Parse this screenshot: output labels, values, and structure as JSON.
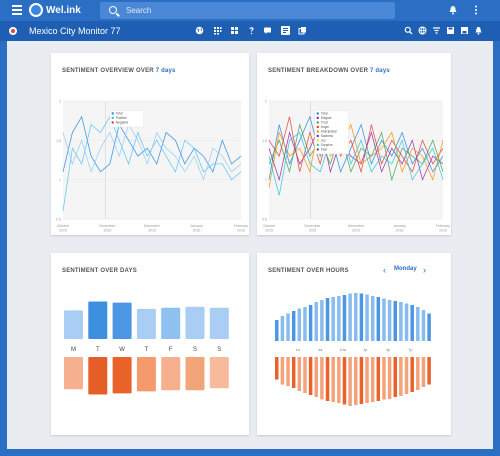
{
  "app": {
    "logo_text": "Wel.ink",
    "search_placeholder": "Search",
    "project_title": "Mexico City Monitor 77"
  },
  "toolbar_icons": [
    "globe-icon",
    "grid-icon",
    "dashboard-icon",
    "help-icon",
    "chat-icon",
    "text-icon",
    "copy-icon"
  ],
  "right_icons": [
    "search-icon",
    "globe-icon",
    "filter-icon",
    "save-icon",
    "save-alt-icon",
    "bell-icon"
  ],
  "cards": {
    "overview": {
      "title": "SENTIMENT OVERVIEW OVER",
      "range": "7 days"
    },
    "breakdown": {
      "title": "SENTIMENT BREAKDOWN OVER",
      "range": "7 days"
    },
    "days": {
      "title": "SENTIMENT OVER DAYS"
    },
    "hours": {
      "title": "SENTIMENT OVER HOURS",
      "day": "Monday",
      "prev": "‹",
      "next": "›"
    }
  },
  "colors": {
    "primary": "#2a6fc4",
    "positive": "#3d8fe0",
    "negative": "#e8622a",
    "grid": "#f2f2f2"
  },
  "chart_data": [
    {
      "type": "line",
      "title": "SENTIMENT OVERVIEW OVER 7 days",
      "x_labels": [
        "October\n2015",
        "November\n2015",
        "December\n2015",
        "January\n2016",
        "February\n2016"
      ],
      "y_ticks": [
        0.5,
        1,
        1.5,
        2
      ],
      "legend": [
        {
          "name": "Total",
          "color": "#1e88e5"
        },
        {
          "name": "Positive",
          "color": "#26c6da"
        },
        {
          "name": "Negative",
          "color": "#e53935"
        }
      ],
      "series": [
        {
          "name": "Total",
          "color": "#1e88e5",
          "values": [
            1.1,
            1.6,
            1.8,
            1.3,
            1.1,
            1.2,
            1.7,
            1.5,
            1.3,
            1.4,
            1.2,
            1.6,
            1.5,
            1.2,
            1.4,
            1.3,
            1.1,
            1.5,
            1.2,
            1.3
          ]
        },
        {
          "name": "Positive",
          "color": "#4fc3f7",
          "values": [
            0.6,
            1.4,
            1.2,
            1.7,
            1.6,
            1.8,
            1.5,
            1.2,
            1.6,
            1.3,
            1.5,
            1.3,
            1.1,
            1.5,
            1.4,
            1.1,
            1.2,
            1.2,
            1.0,
            1.1
          ]
        },
        {
          "name": "Negative",
          "color": "#90caf9",
          "values": [
            1.6,
            1.2,
            1.5,
            1.1,
            1.4,
            1.6,
            1.3,
            1.7,
            1.5,
            1.2,
            1.6,
            1.4,
            1.3,
            1.1,
            1.3,
            1.0,
            1.4,
            1.3,
            1.1,
            1.2
          ]
        }
      ]
    },
    {
      "type": "line",
      "title": "SENTIMENT BREAKDOWN OVER 7 days",
      "x_labels": [
        "October\n2015",
        "November\n2015",
        "December\n2015",
        "January\n2016",
        "February\n2016"
      ],
      "y_ticks": [
        0.5,
        1,
        1.5,
        2
      ],
      "legend": [
        {
          "name": "Total",
          "color": "#1e88e5"
        },
        {
          "name": "Disgust",
          "color": "#8e24aa"
        },
        {
          "name": "Trust",
          "color": "#43a047"
        },
        {
          "name": "Anger",
          "color": "#e53935"
        },
        {
          "name": "Anticipation",
          "color": "#fb8c00"
        },
        {
          "name": "Sadness",
          "color": "#5e35b1"
        },
        {
          "name": "Joy",
          "color": "#fdd835"
        },
        {
          "name": "Surprise",
          "color": "#26c6da"
        },
        {
          "name": "Fear",
          "color": "#6d4c41"
        }
      ],
      "series": [
        {
          "name": "Total",
          "color": "#1e88e5",
          "values": [
            1.0,
            1.7,
            1.2,
            1.5,
            1.8,
            1.3,
            1.6,
            1.1,
            1.4,
            1.7,
            1.2,
            1.5,
            1.3,
            1.6,
            1.2,
            1.4,
            1.1,
            1.3
          ]
        },
        {
          "name": "Disgust",
          "color": "#8e24aa",
          "values": [
            1.4,
            1.0,
            1.6,
            1.2,
            1.4,
            1.7,
            1.1,
            1.5,
            1.3,
            1.2,
            1.6,
            1.1,
            1.4,
            1.2,
            1.5,
            1.0,
            1.3,
            1.2
          ]
        },
        {
          "name": "Trust",
          "color": "#43a047",
          "values": [
            1.2,
            1.5,
            1.1,
            1.7,
            1.3,
            1.5,
            1.2,
            1.6,
            1.1,
            1.4,
            1.3,
            1.6,
            1.0,
            1.4,
            1.3,
            1.2,
            1.5,
            1.1
          ]
        },
        {
          "name": "Anger",
          "color": "#e53935",
          "values": [
            1.5,
            1.3,
            1.8,
            1.1,
            1.6,
            1.2,
            1.7,
            1.3,
            1.5,
            1.1,
            1.7,
            1.2,
            1.5,
            1.3,
            1.1,
            1.5,
            1.2,
            1.4
          ]
        },
        {
          "name": "Anticipation",
          "color": "#fb8c00",
          "values": [
            0.9,
            1.6,
            1.3,
            1.4,
            1.1,
            1.8,
            1.3,
            1.4,
            1.7,
            1.2,
            1.3,
            1.4,
            1.6,
            1.1,
            1.4,
            1.3,
            1.0,
            1.5
          ]
        },
        {
          "name": "Surprise",
          "color": "#26c6da",
          "values": [
            1.3,
            0.8,
            1.5,
            1.6,
            1.2,
            1.1,
            1.5,
            1.7,
            1.2,
            1.5,
            1.1,
            1.3,
            1.2,
            1.5,
            1.0,
            1.2,
            1.4,
            1.0
          ]
        }
      ]
    },
    {
      "type": "bar",
      "title": "SENTIMENT OVER DAYS",
      "categories": [
        "M",
        "T",
        "W",
        "T",
        "F",
        "S",
        "S"
      ],
      "series": [
        {
          "name": "Positive",
          "values": [
            0.55,
            0.72,
            0.7,
            0.58,
            0.6,
            0.62,
            0.6
          ],
          "colors": [
            "#a9cdf3",
            "#3d8fe0",
            "#4b97e3",
            "#a9cdf3",
            "#8ec0f0",
            "#a9cdf3",
            "#a9cdf3"
          ]
        },
        {
          "name": "Negative",
          "values": [
            0.62,
            0.72,
            0.7,
            0.66,
            0.64,
            0.64,
            0.6
          ],
          "colors": [
            "#f6b08d",
            "#e55e27",
            "#e8622a",
            "#f49a6c",
            "#f6b08d",
            "#f3a57a",
            "#f7bb9b"
          ]
        }
      ]
    },
    {
      "type": "bar",
      "title": "SENTIMENT OVER HOURS",
      "categories": [
        "1a",
        "4a",
        "10a",
        "1p",
        "4p",
        "7p"
      ],
      "series": [
        {
          "name": "Positive",
          "values": [
            0.42,
            0.5,
            0.55,
            0.6,
            0.65,
            0.68,
            0.72,
            0.78,
            0.82,
            0.86,
            0.88,
            0.9,
            0.92,
            0.95,
            0.96,
            0.95,
            0.93,
            0.9,
            0.88,
            0.85,
            0.82,
            0.8,
            0.78,
            0.75,
            0.72,
            0.68,
            0.62,
            0.55
          ]
        },
        {
          "name": "Negative",
          "values": [
            0.45,
            0.55,
            0.58,
            0.62,
            0.68,
            0.72,
            0.76,
            0.8,
            0.85,
            0.88,
            0.9,
            0.92,
            0.95,
            0.98,
            0.96,
            0.94,
            0.92,
            0.9,
            0.88,
            0.85,
            0.84,
            0.8,
            0.78,
            0.74,
            0.7,
            0.66,
            0.6,
            0.55
          ]
        }
      ]
    }
  ]
}
